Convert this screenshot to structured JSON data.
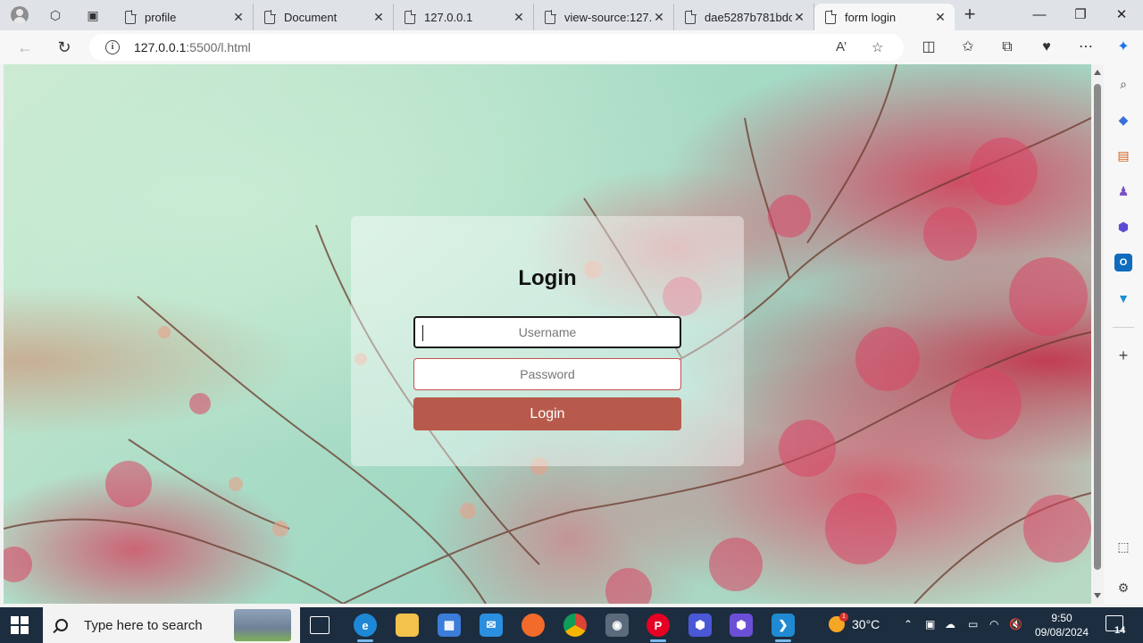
{
  "browser": {
    "tabs": [
      {
        "title": "profile",
        "active": false
      },
      {
        "title": "Document",
        "active": false
      },
      {
        "title": "127.0.0.1",
        "active": false
      },
      {
        "title": "view-source:127.0.",
        "active": false
      },
      {
        "title": "dae5287b781bdc",
        "active": false
      },
      {
        "title": "form login",
        "active": true
      }
    ],
    "new_tab_label": "+",
    "address": {
      "host": "127.0.0.1",
      "rest": ":5500/l.html"
    }
  },
  "login_form": {
    "title": "Login",
    "username_placeholder": "Username",
    "password_placeholder": "Password",
    "submit_label": "Login"
  },
  "sidebar": {
    "icons": [
      "search-icon",
      "shopping-tag-icon",
      "tools-icon",
      "games-icon",
      "copilot-icon",
      "outlook-icon",
      "send-icon",
      "add-icon",
      "screenshot-icon",
      "settings-icon"
    ]
  },
  "taskbar": {
    "search_placeholder": "Type here to search",
    "apps": [
      "task-view-icon",
      "edge-icon",
      "file-explorer-icon",
      "store-icon",
      "mail-icon",
      "firefox-icon",
      "chrome-icon",
      "camera-icon",
      "pinterest-icon",
      "app-icon",
      "visual-studio-icon",
      "vscode-icon"
    ],
    "weather": {
      "temperature": "30°C",
      "badge": "1"
    },
    "clock": {
      "time": "9:50",
      "date": "09/08/2024"
    },
    "notification_count": "14"
  },
  "colors": {
    "login_button": "#b85a4b",
    "password_border": "#c0504d",
    "taskbar_bg": "#1c2d3f",
    "tab_strip_bg": "#dfe3e8"
  }
}
